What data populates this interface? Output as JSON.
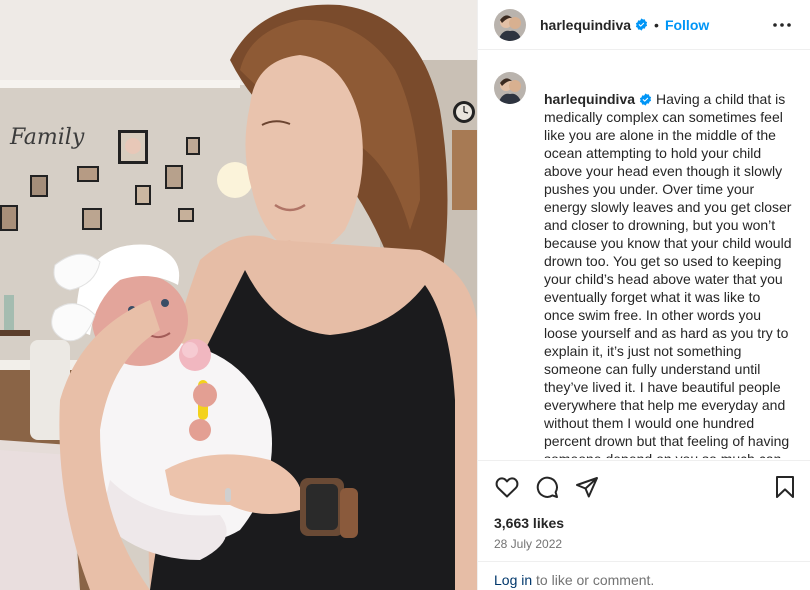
{
  "post": {
    "username": "harlequindiva",
    "follow_label": "Follow",
    "separator": "•",
    "caption": "Having a child that is medically complex can sometimes feel like you are alone in the middle of the ocean attempting to hold your child above your head even though it slowly pushes you under. Over time your energy slowly leaves and you get closer and closer to drowning, but you won’t because you know that your child would drown too. You get so used to keeping your child’s head above water that you eventually forget what it was like to once swim free. In other words you loose yourself and as hard as you try to explain it, it’s just not something someone can fully understand until they’ve lived it. I have beautiful people everywhere that help me everyday and without them I would one hundred percent drown but that feeling of having someone depend on you so much can feel so",
    "likes": "3,663 likes",
    "date": "28 July 2022",
    "login_label": "Log in",
    "comment_prompt": " to like or comment."
  },
  "photo": {
    "wall_sign": "Family",
    "clock_label": "wall clock"
  },
  "icons": {
    "verified": "verified-badge-icon",
    "more": "more-options-icon",
    "like": "heart-icon",
    "comment": "comment-icon",
    "share": "share-icon",
    "save": "bookmark-icon"
  },
  "colors": {
    "accent": "#0095f6",
    "verified": "#0095f6",
    "link": "#00376b",
    "muted": "#737373",
    "text": "#262626"
  }
}
